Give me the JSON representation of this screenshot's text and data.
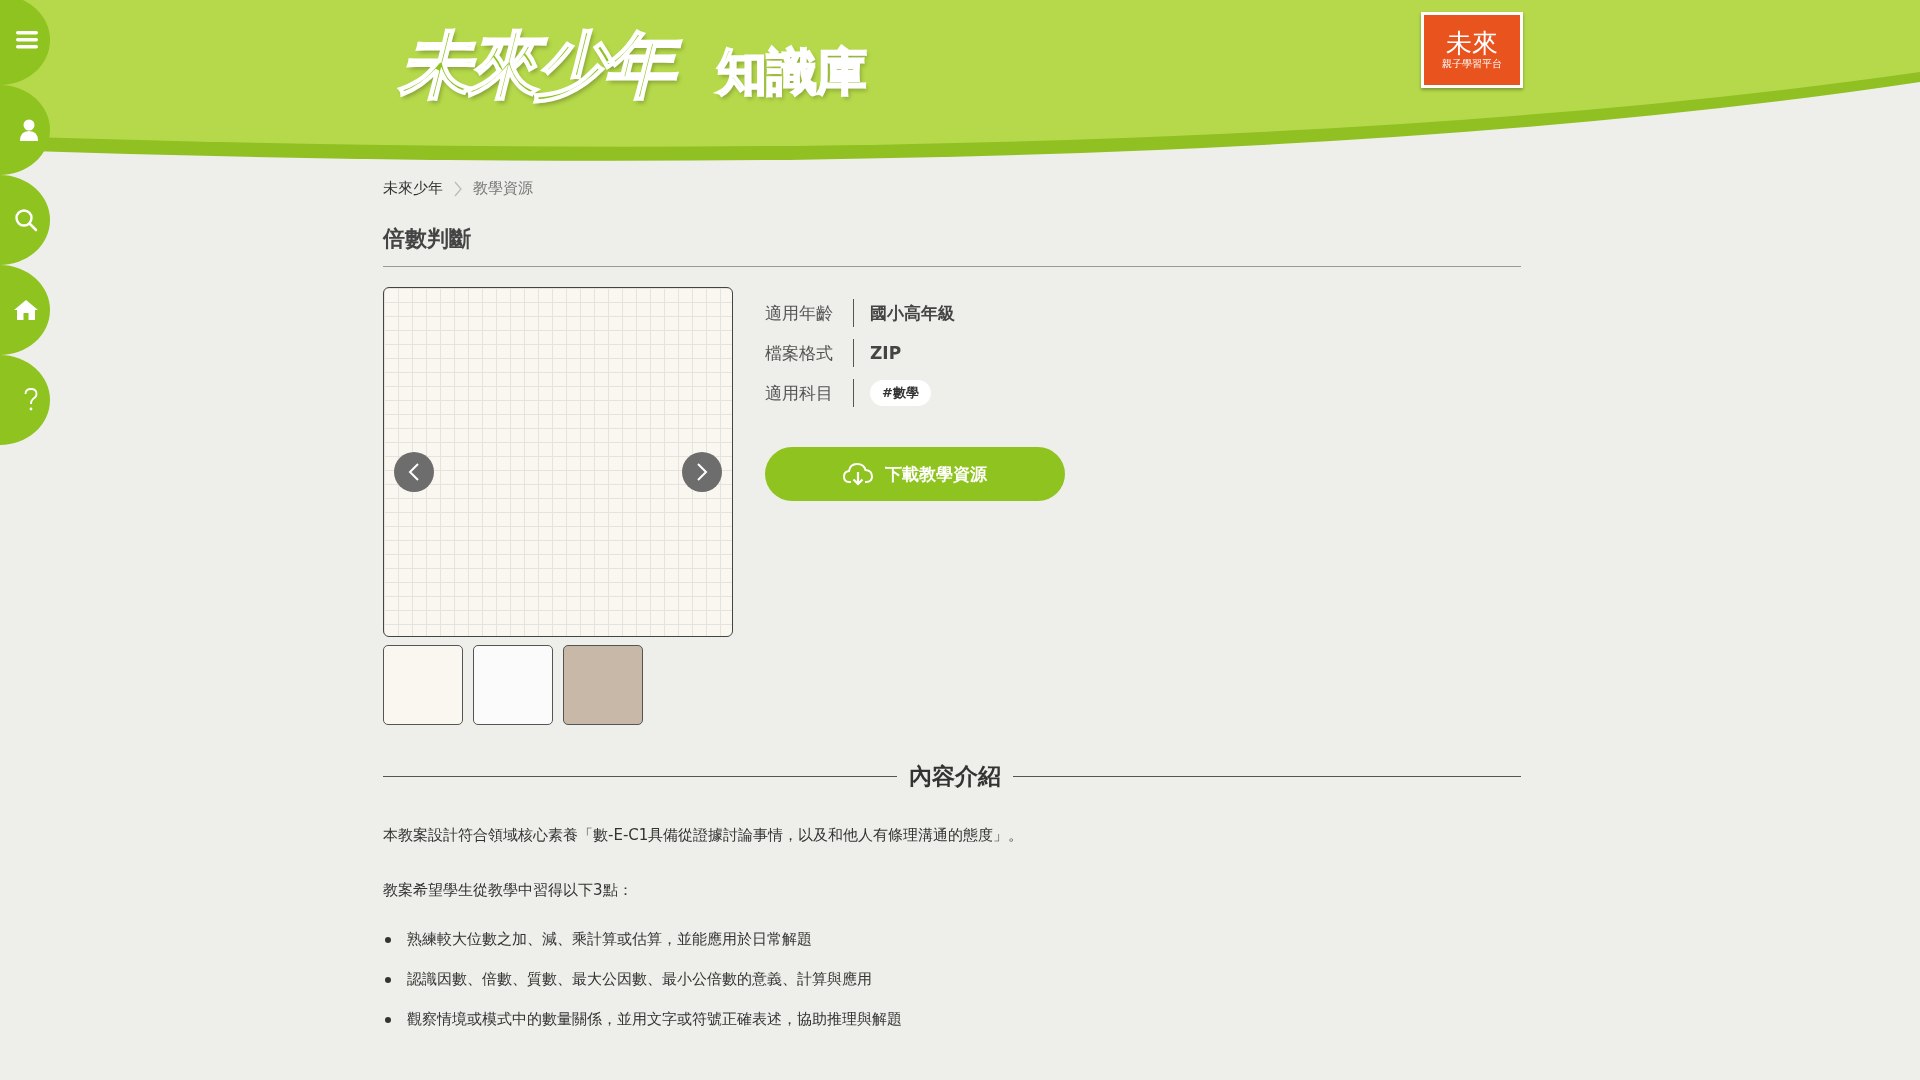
{
  "sidebar": {
    "items": [
      {
        "kind": "menu"
      },
      {
        "kind": "user"
      },
      {
        "kind": "search"
      },
      {
        "kind": "home"
      },
      {
        "kind": "help"
      }
    ]
  },
  "header": {
    "logo_title": "未來少年",
    "logo_subtitle": "知識庫",
    "badge_title": "未來",
    "badge_subtitle": "親子學習平台"
  },
  "breadcrumb": [
    "未來少年",
    "教學資源"
  ],
  "title": "倍數判斷",
  "gallery": {
    "thumbnails": [
      {
        "kind": "cover"
      },
      {
        "kind": "document"
      },
      {
        "kind": "poster"
      }
    ]
  },
  "info": [
    {
      "label": "適用年齡",
      "kind": "text",
      "value": "國小高年級"
    },
    {
      "label": "檔案格式",
      "kind": "text",
      "value": "ZIP"
    },
    {
      "label": "適用科目",
      "kind": "tag",
      "value": "#數學"
    }
  ],
  "download_button": "下載教學資源",
  "section_heading": "內容介紹",
  "paragraphs": [
    "本教案設計符合領域核心素養「數-E-C1具備從證據討論事情，以及和他人有條理溝通的態度」。",
    "教案希望學生從教學中習得以下3點："
  ],
  "bullets": [
    "熟練較大位數之加、減、乘計算或估算，並能應用於日常解題",
    "認識因數、倍數、質數、最大公因數、最小公倍數的意義、計算與應用",
    "觀察情境或模式中的數量關係，並用文字或符號正確表述，協助推理與解題"
  ]
}
